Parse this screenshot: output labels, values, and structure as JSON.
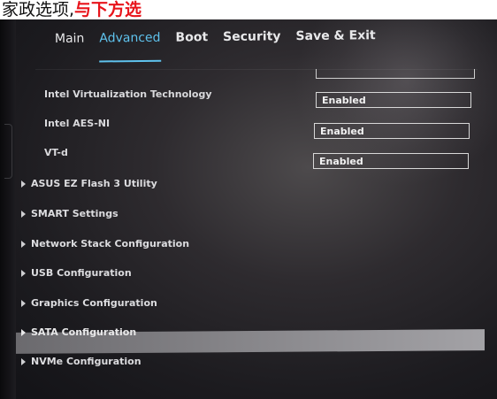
{
  "caption": {
    "text_black": "家政选项,",
    "text_red": "与下方选"
  },
  "tabs": [
    {
      "label": "Main",
      "active": false
    },
    {
      "label": "Advanced",
      "active": true
    },
    {
      "label": "Boot",
      "active": false
    },
    {
      "label": "Security",
      "active": false
    },
    {
      "label": "Save & Exit",
      "active": false
    }
  ],
  "settings": [
    {
      "label": "Intel Virtualization Technology",
      "value": "Enabled"
    },
    {
      "label": "Intel AES-NI",
      "value": "Enabled"
    },
    {
      "label": "VT-d",
      "value": "Enabled"
    }
  ],
  "menu": [
    {
      "label": "ASUS EZ Flash 3 Utility",
      "selected": false
    },
    {
      "label": "SMART Settings",
      "selected": false
    },
    {
      "label": "Network Stack Configuration",
      "selected": false
    },
    {
      "label": "USB Configuration",
      "selected": false
    },
    {
      "label": "Graphics Configuration",
      "selected": false
    },
    {
      "label": "SATA Configuration",
      "selected": true
    },
    {
      "label": "NVMe Configuration",
      "selected": false
    }
  ],
  "colors": {
    "accent": "#5fc3ee",
    "caption_red": "#e8141b",
    "highlight": "#8d8c90"
  }
}
